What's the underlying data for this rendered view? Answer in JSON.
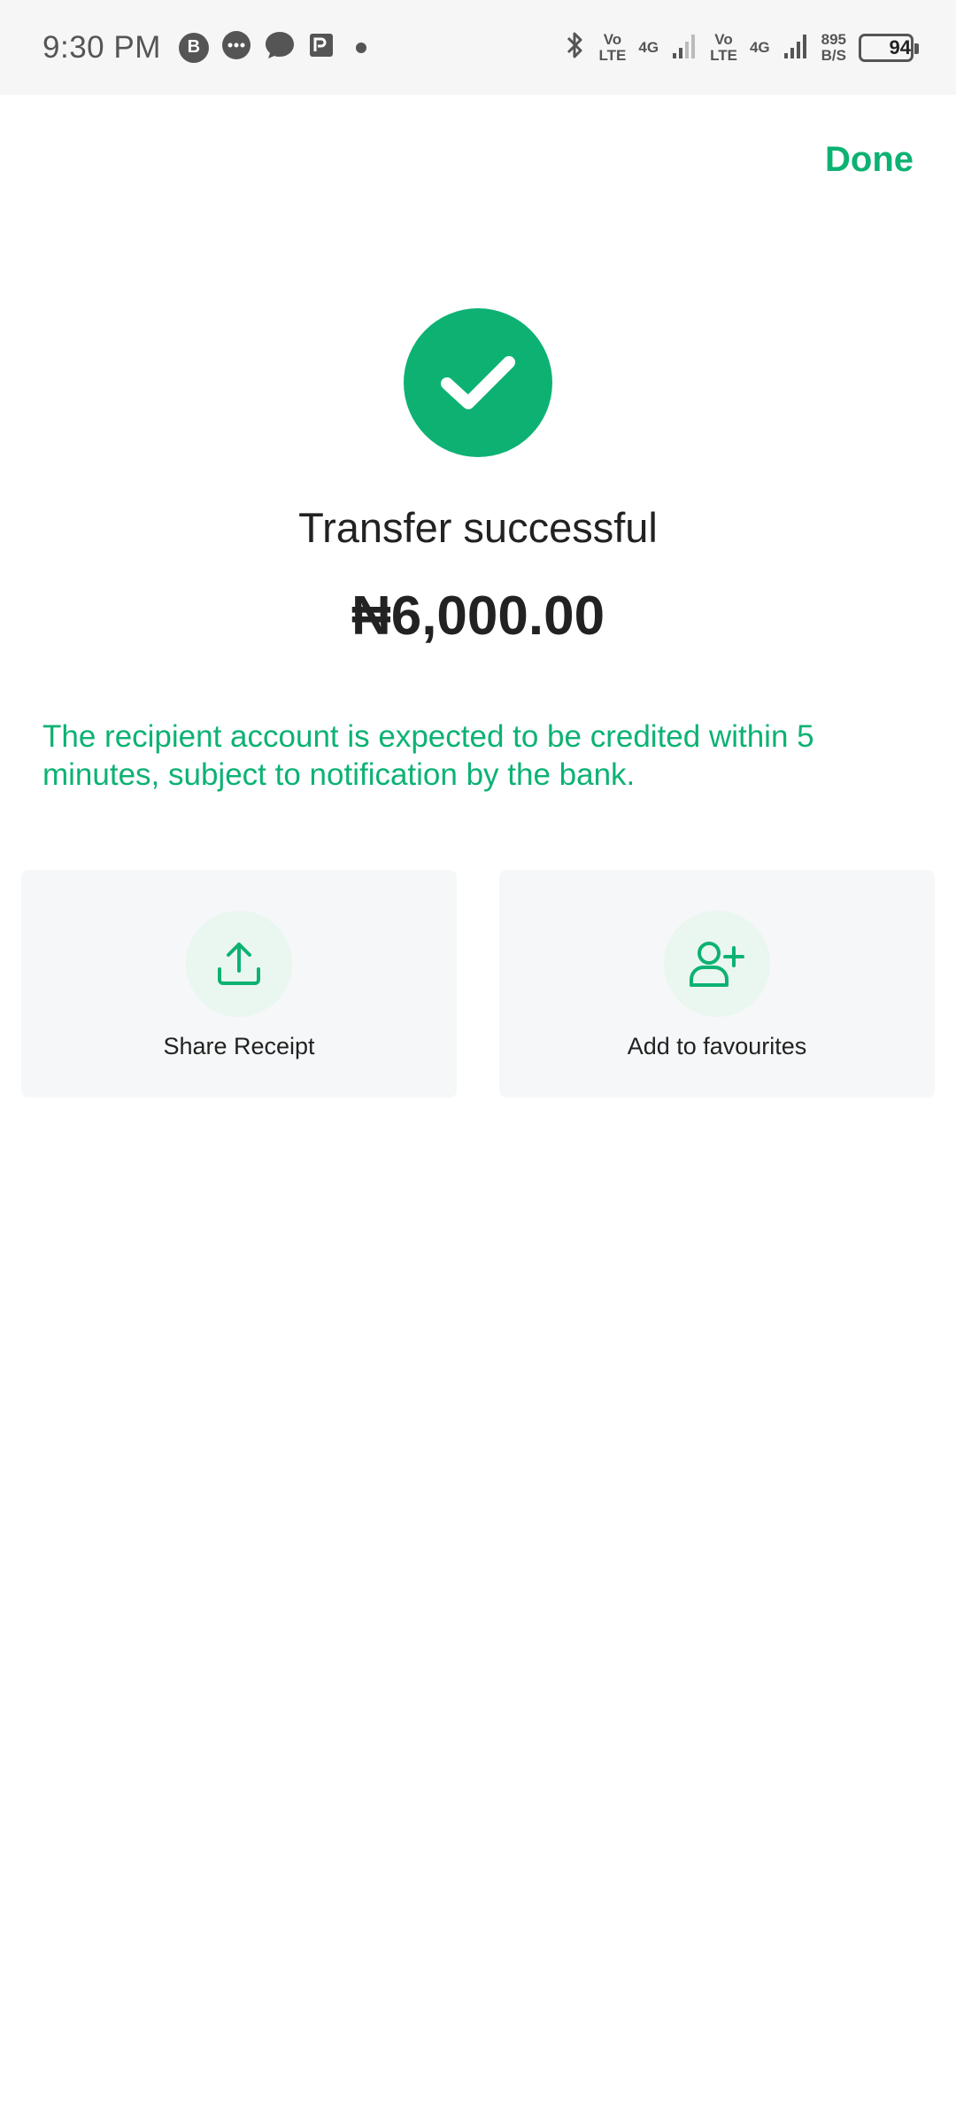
{
  "status_bar": {
    "time": "9:30 PM",
    "notification_icons": [
      "b-icon",
      "chat-bubble-dots-icon",
      "chat-bubble-icon",
      "p-app-icon"
    ],
    "sim1": {
      "top": "Vo",
      "bottom": "LTE",
      "network": "4G"
    },
    "sim2": {
      "top": "Vo",
      "bottom": "LTE",
      "network": "4G"
    },
    "speed_value": "895",
    "speed_unit": "B/S",
    "battery": "94"
  },
  "header": {
    "done_label": "Done"
  },
  "result": {
    "title": "Transfer successful",
    "amount": "₦6,000.00",
    "notice": "The recipient account is expected to be credited within 5 minutes, subject to notification by the bank."
  },
  "actions": [
    {
      "label": "Share Receipt",
      "icon": "share-upload-icon"
    },
    {
      "label": "Add to favourites",
      "icon": "add-user-icon"
    }
  ],
  "colors": {
    "accent": "#0db273",
    "card_bg": "#f6f7f8",
    "icon_bg": "#eaf6f0"
  }
}
